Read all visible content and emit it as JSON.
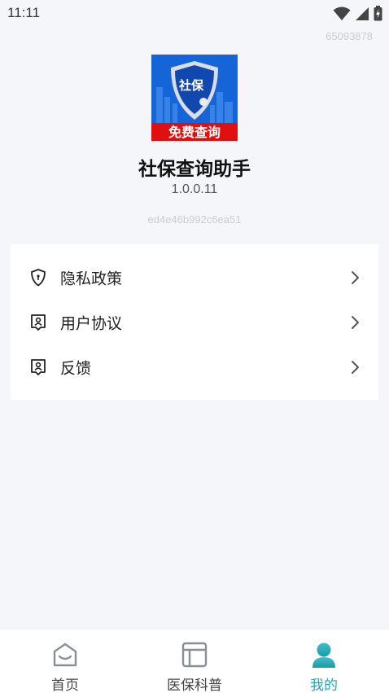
{
  "status_bar": {
    "time": "11:11"
  },
  "device_id": "65093878",
  "app": {
    "logo_top_text": "社保",
    "logo_banner_text": "免费查询",
    "name": "社保查询助手",
    "version": "1.0.0.11",
    "hash": "ed4e46b992c6ea51"
  },
  "menu": [
    {
      "label": "隐私政策",
      "icon": "shield-icon"
    },
    {
      "label": "用户协议",
      "icon": "document-icon"
    },
    {
      "label": "反馈",
      "icon": "feedback-icon"
    }
  ],
  "bottom_nav": [
    {
      "label": "首页",
      "icon": "home-icon",
      "active": false
    },
    {
      "label": "医保科普",
      "icon": "book-icon",
      "active": false
    },
    {
      "label": "我的",
      "icon": "user-icon",
      "active": true
    }
  ],
  "colors": {
    "accent": "#2aa5b3",
    "background": "#f5f6fa",
    "logo_blue": "#1565d8",
    "logo_red": "#e01010"
  }
}
